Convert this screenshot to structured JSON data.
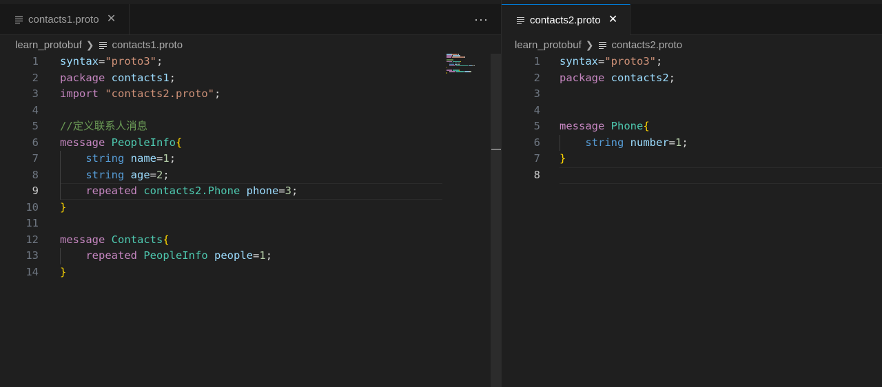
{
  "left_group": {
    "tab": {
      "label": "contacts1.proto",
      "close": "✕",
      "icon": "file-lines-icon"
    },
    "more_actions": "···",
    "breadcrumb": {
      "folder": "learn_protobuf",
      "file": "contacts1.proto"
    },
    "lines": [
      {
        "n": "1",
        "tokens": [
          [
            "var",
            "syntax"
          ],
          [
            "op",
            "="
          ],
          [
            "str",
            "\"proto3\""
          ],
          [
            "op",
            ";"
          ]
        ]
      },
      {
        "n": "2",
        "tokens": [
          [
            "kw",
            "package"
          ],
          [
            "op",
            " "
          ],
          [
            "var",
            "contacts1"
          ],
          [
            "op",
            ";"
          ]
        ]
      },
      {
        "n": "3",
        "tokens": [
          [
            "kw",
            "import"
          ],
          [
            "op",
            " "
          ],
          [
            "str",
            "\"contacts2.proto\""
          ],
          [
            "op",
            ";"
          ]
        ]
      },
      {
        "n": "4",
        "tokens": []
      },
      {
        "n": "5",
        "tokens": [
          [
            "cmt",
            "//定义联系人消息"
          ]
        ]
      },
      {
        "n": "6",
        "tokens": [
          [
            "kw",
            "message"
          ],
          [
            "op",
            " "
          ],
          [
            "cls",
            "PeopleInfo"
          ],
          [
            "brace",
            "{"
          ]
        ]
      },
      {
        "n": "7",
        "tokens": [
          [
            "op",
            "    "
          ],
          [
            "type",
            "string"
          ],
          [
            "op",
            " "
          ],
          [
            "var",
            "name"
          ],
          [
            "op",
            "="
          ],
          [
            "num",
            "1"
          ],
          [
            "op",
            ";"
          ]
        ]
      },
      {
        "n": "8",
        "tokens": [
          [
            "op",
            "    "
          ],
          [
            "type",
            "string"
          ],
          [
            "op",
            " "
          ],
          [
            "var",
            "age"
          ],
          [
            "op",
            "="
          ],
          [
            "num",
            "2"
          ],
          [
            "op",
            ";"
          ]
        ]
      },
      {
        "n": "9",
        "tokens": [
          [
            "op",
            "    "
          ],
          [
            "kw",
            "repeated"
          ],
          [
            "op",
            " "
          ],
          [
            "cls",
            "contacts2.Phone"
          ],
          [
            "op",
            " "
          ],
          [
            "var",
            "phone"
          ],
          [
            "op",
            "="
          ],
          [
            "num",
            "3"
          ],
          [
            "op",
            ";"
          ]
        ]
      },
      {
        "n": "10",
        "tokens": [
          [
            "brace",
            "}"
          ]
        ]
      },
      {
        "n": "11",
        "tokens": []
      },
      {
        "n": "12",
        "tokens": [
          [
            "kw",
            "message"
          ],
          [
            "op",
            " "
          ],
          [
            "cls",
            "Contacts"
          ],
          [
            "brace",
            "{"
          ]
        ]
      },
      {
        "n": "13",
        "tokens": [
          [
            "op",
            "    "
          ],
          [
            "kw",
            "repeated"
          ],
          [
            "op",
            " "
          ],
          [
            "cls",
            "PeopleInfo"
          ],
          [
            "op",
            " "
          ],
          [
            "var",
            "people"
          ],
          [
            "op",
            "="
          ],
          [
            "num",
            "1"
          ],
          [
            "op",
            ";"
          ]
        ]
      },
      {
        "n": "14",
        "tokens": [
          [
            "brace",
            "}"
          ]
        ]
      }
    ],
    "active_line": "9"
  },
  "right_group": {
    "tab": {
      "label": "contacts2.proto",
      "close": "✕",
      "icon": "file-lines-icon"
    },
    "breadcrumb": {
      "folder": "learn_protobuf",
      "file": "contacts2.proto"
    },
    "lines": [
      {
        "n": "1",
        "tokens": [
          [
            "var",
            "syntax"
          ],
          [
            "op",
            "="
          ],
          [
            "str",
            "\"proto3\""
          ],
          [
            "op",
            ";"
          ]
        ]
      },
      {
        "n": "2",
        "tokens": [
          [
            "kw",
            "package"
          ],
          [
            "op",
            " "
          ],
          [
            "var",
            "contacts2"
          ],
          [
            "op",
            ";"
          ]
        ]
      },
      {
        "n": "3",
        "tokens": []
      },
      {
        "n": "4",
        "tokens": []
      },
      {
        "n": "5",
        "tokens": [
          [
            "kw",
            "message"
          ],
          [
            "op",
            " "
          ],
          [
            "cls",
            "Phone"
          ],
          [
            "brace",
            "{"
          ]
        ]
      },
      {
        "n": "6",
        "tokens": [
          [
            "op",
            "    "
          ],
          [
            "type",
            "string"
          ],
          [
            "op",
            " "
          ],
          [
            "var",
            "number"
          ],
          [
            "op",
            "="
          ],
          [
            "num",
            "1"
          ],
          [
            "op",
            ";"
          ]
        ]
      },
      {
        "n": "7",
        "tokens": [
          [
            "brace",
            "}"
          ]
        ]
      },
      {
        "n": "8",
        "tokens": []
      }
    ],
    "active_line": "8"
  },
  "colors": {
    "keyword": "#c586c0",
    "string": "#ce9178",
    "type": "#569cd6",
    "class": "#4ec9b0",
    "variable": "#9cdcfe",
    "number": "#b5cea8",
    "comment": "#6a9955",
    "brace": "#ffd700",
    "accent": "#0078d4",
    "background": "#1f1f1f"
  }
}
